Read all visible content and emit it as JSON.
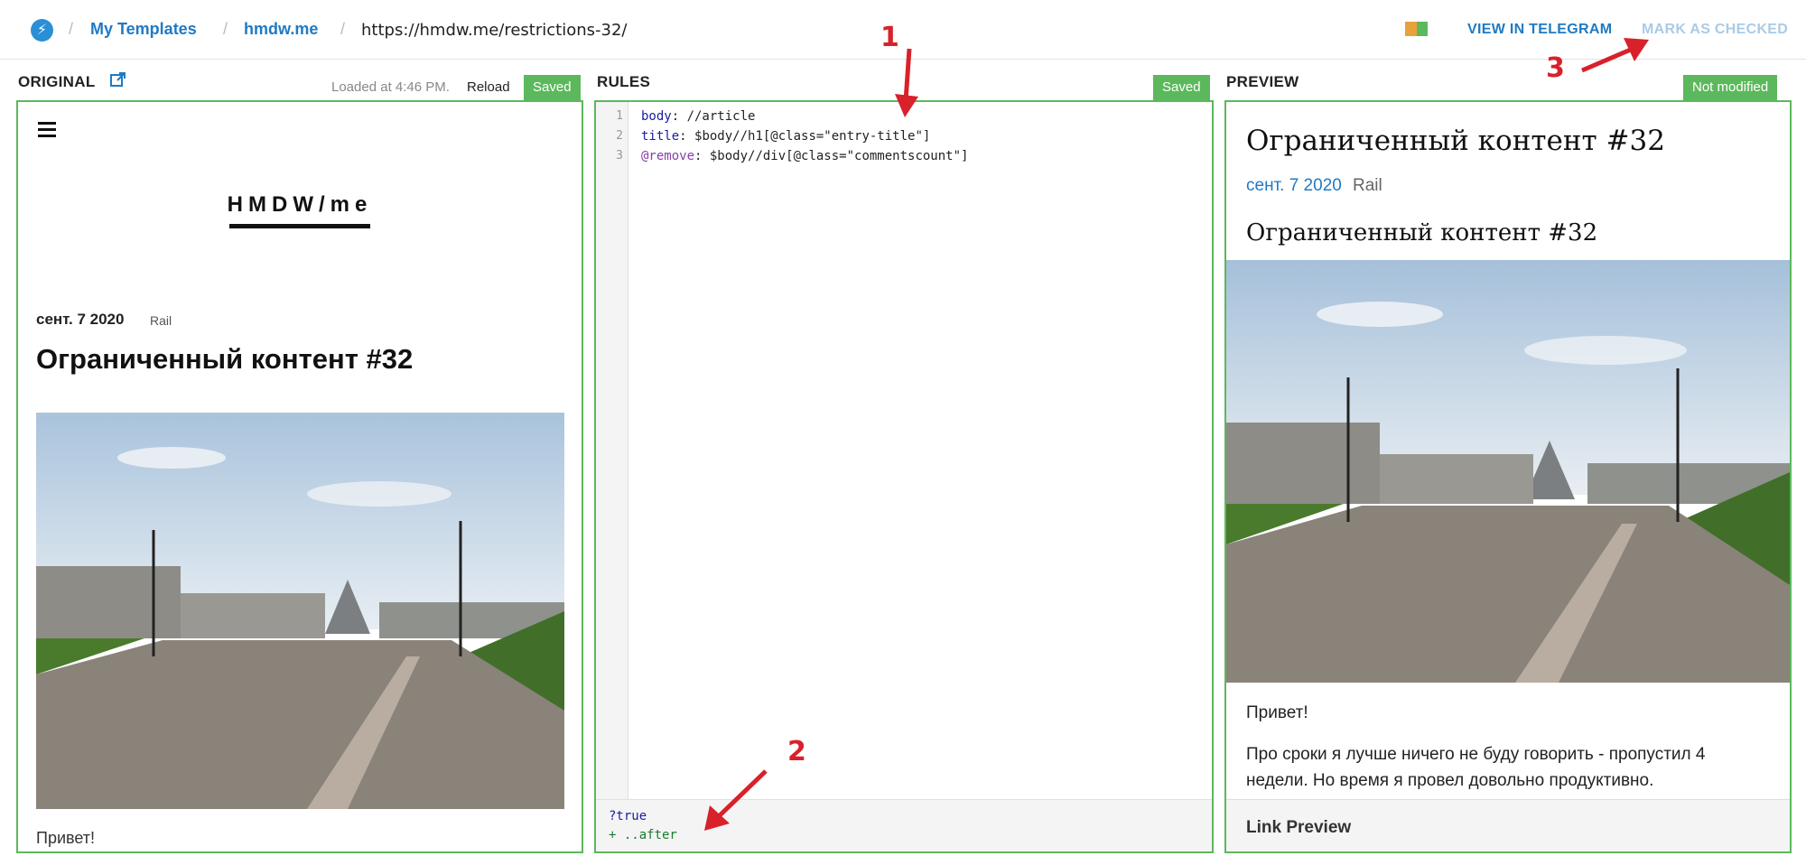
{
  "header": {
    "logo_glyph": "⚡",
    "breadcrumbs": [
      {
        "label": "My Templates"
      },
      {
        "label": "hmdw.me"
      }
    ],
    "separator": "/",
    "url": "https://hmdw.me/restrictions-32/",
    "flag_colors": [
      "#e8a23c",
      "#5cb85c"
    ],
    "view_in_telegram": "VIEW IN TELEGRAM",
    "mark_as_checked": "MARK AS CHECKED"
  },
  "original": {
    "title": "ORIGINAL",
    "loaded_text": "Loaded at 4:46 PM.",
    "reload_label": "Reload",
    "status": "Saved",
    "site_title": "HMDW/me",
    "date": "сент. 7 2020",
    "author": "Rail",
    "article_title": "Ограниченный контент #32",
    "first_paragraph": "Привет!"
  },
  "rules": {
    "title": "RULES",
    "status": "Saved",
    "line_numbers": [
      "1",
      "2",
      "3"
    ],
    "lines": [
      {
        "key": "body",
        "rest": ": //article"
      },
      {
        "key": "title",
        "rest": ": $body//h1[@class=\"entry-title\"]"
      },
      {
        "key": "@remove",
        "rest": ": $body//div[@class=\"commentscount\"]"
      }
    ],
    "console_lines": [
      "?true",
      "+ ..after"
    ]
  },
  "preview": {
    "title": "PREVIEW",
    "status": "Not modified",
    "article_title": "Ограниченный контент #32",
    "date": "сент. 7 2020",
    "author": "Rail",
    "subtitle": "Ограниченный контент #32",
    "paragraph_1": "Привет!",
    "paragraph_2": "Про сроки я лучше ничего не буду говорить - пропустил 4 недели. Но время я провел довольно продуктивно.",
    "link_preview": "Link Preview"
  },
  "annotations": [
    {
      "label": "1"
    },
    {
      "label": "2"
    },
    {
      "label": "3"
    }
  ],
  "colors": {
    "accent": "#1f7ac4",
    "status_green": "#5cb85c",
    "annotation_red": "#d8212a"
  }
}
